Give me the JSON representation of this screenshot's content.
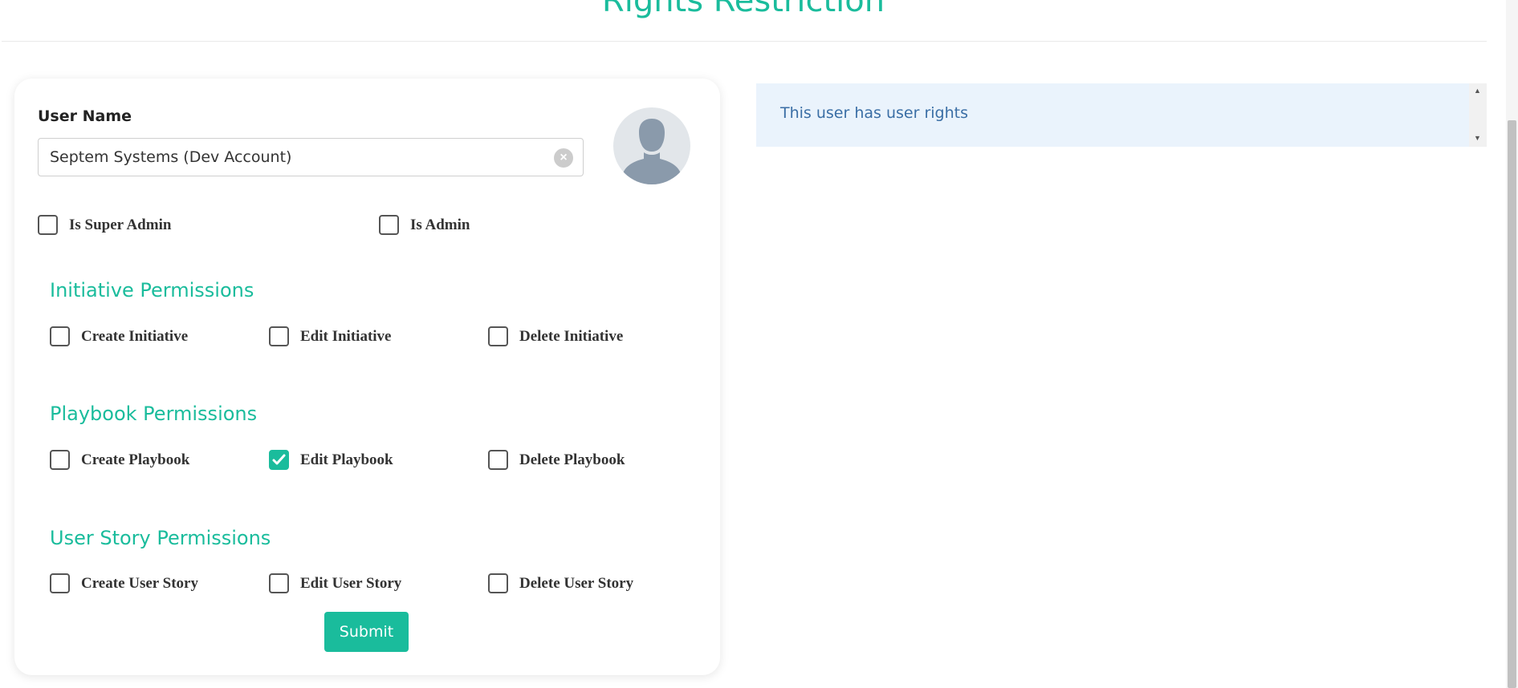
{
  "header": {
    "title": "Rights Restriction"
  },
  "form": {
    "user_name_label": "User Name",
    "user_name_value": "Septem Systems (Dev Account)",
    "admin_options": [
      {
        "label": "Is Super Admin",
        "checked": false
      },
      {
        "label": "Is Admin",
        "checked": false
      }
    ],
    "sections": [
      {
        "title": "Initiative Permissions",
        "options": [
          {
            "label": "Create Initiative",
            "checked": false
          },
          {
            "label": "Edit Initiative",
            "checked": false
          },
          {
            "label": "Delete Initiative",
            "checked": false
          }
        ]
      },
      {
        "title": "Playbook Permissions",
        "options": [
          {
            "label": "Create Playbook",
            "checked": false
          },
          {
            "label": "Edit Playbook",
            "checked": true
          },
          {
            "label": "Delete Playbook",
            "checked": false
          }
        ]
      },
      {
        "title": "User Story Permissions",
        "options": [
          {
            "label": "Create User Story",
            "checked": false
          },
          {
            "label": "Edit User Story",
            "checked": false
          },
          {
            "label": "Delete User Story",
            "checked": false
          }
        ]
      }
    ],
    "submit_label": "Submit"
  },
  "info": {
    "message": "This user has user rights"
  },
  "colors": {
    "accent": "#1abc9c",
    "info_bg": "#eaf3fc",
    "info_text": "#3a6ea5"
  },
  "icons": {
    "clear": "close-circle-icon",
    "avatar": "user-silhouette-icon",
    "check": "check-icon"
  }
}
